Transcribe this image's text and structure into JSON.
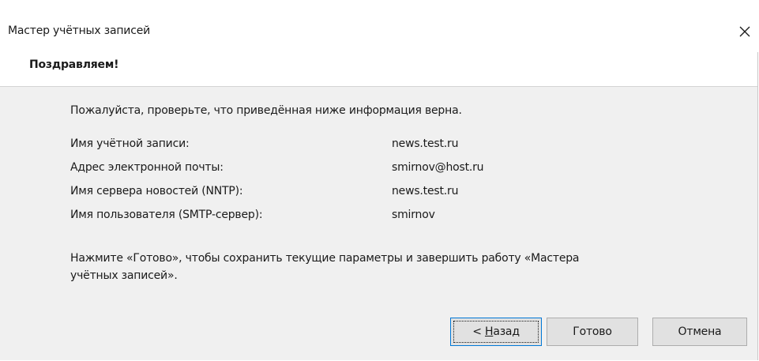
{
  "window": {
    "title": "Мастер учётных записей",
    "close_glyph": "✕"
  },
  "header": {
    "heading": "Поздравляем!"
  },
  "body": {
    "intro": "Пожалуйста, проверьте, что приведённая ниже информация верна.",
    "rows": [
      {
        "label": "Имя учётной записи:",
        "value": "news.test.ru"
      },
      {
        "label": "Адрес электронной почты:",
        "value": "smirnov@host.ru"
      },
      {
        "label": "Имя сервера новостей (NNTP):",
        "value": "news.test.ru"
      },
      {
        "label": "Имя пользователя (SMTP-сервер):",
        "value": "smirnov"
      }
    ],
    "note_line1": "Нажмите «Готово», чтобы сохранить текущие параметры и завершить работу «Мастера",
    "note_line2": "учётных записей»."
  },
  "buttons": {
    "back_prefix": "< ",
    "back_mnemonic": "Н",
    "back_rest": "азад",
    "finish": "Готово",
    "cancel": "Отмена"
  },
  "colors": {
    "body_bg": "#f0f0f0",
    "button_bg": "#e1e1e1",
    "focus_border": "#0078d7"
  }
}
